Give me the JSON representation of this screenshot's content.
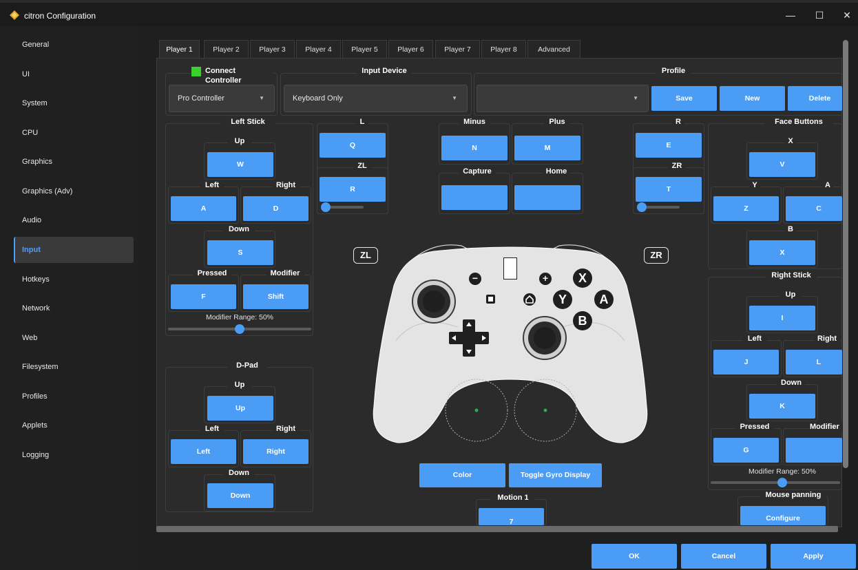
{
  "window": {
    "title": "citron Configuration",
    "minimize": "—",
    "maximize": "☐",
    "close": "✕"
  },
  "sidebar": {
    "items": [
      {
        "label": "General"
      },
      {
        "label": "UI"
      },
      {
        "label": "System"
      },
      {
        "label": "CPU"
      },
      {
        "label": "Graphics"
      },
      {
        "label": "Graphics (Adv)"
      },
      {
        "label": "Audio"
      },
      {
        "label": "Input"
      },
      {
        "label": "Hotkeys"
      },
      {
        "label": "Network"
      },
      {
        "label": "Web"
      },
      {
        "label": "Filesystem"
      },
      {
        "label": "Profiles"
      },
      {
        "label": "Applets"
      },
      {
        "label": "Logging"
      }
    ],
    "active": "Input"
  },
  "tabs": [
    "Player 1",
    "Player 2",
    "Player 3",
    "Player 4",
    "Player 5",
    "Player 6",
    "Player 7",
    "Player 8",
    "Advanced"
  ],
  "header": {
    "connect_label": "Connect Controller",
    "controller_type": "Pro Controller",
    "input_device_label": "Input Device",
    "input_device": "Keyboard Only",
    "profile_label": "Profile",
    "profile_value": "",
    "save": "Save",
    "new": "New",
    "delete": "Delete"
  },
  "left_stick": {
    "title": "Left Stick",
    "up_label": "Up",
    "up": "W",
    "left_label": "Left",
    "left": "A",
    "right_label": "Right",
    "right": "D",
    "down_label": "Down",
    "down": "S",
    "pressed_label": "Pressed",
    "pressed": "F",
    "modifier_label": "Modifier",
    "modifier": "Shift",
    "range_text": "Modifier Range: 50%",
    "range_value": 0.5
  },
  "dpad": {
    "title": "D-Pad",
    "up_label": "Up",
    "up": "Up",
    "left_label": "Left",
    "left": "Left",
    "right_label": "Right",
    "right": "Right",
    "down_label": "Down",
    "down": "Down"
  },
  "shoulder_l": {
    "l_label": "L",
    "l": "Q",
    "zl_label": "ZL",
    "zl": "R",
    "zl_range": 0.05
  },
  "shoulder_r": {
    "r_label": "R",
    "r": "E",
    "zr_label": "ZR",
    "zr": "T",
    "zr_range": 0.05
  },
  "misc": {
    "minus_label": "Minus",
    "minus": "N",
    "plus_label": "Plus",
    "plus": "M",
    "capture_label": "Capture",
    "capture": "",
    "home_label": "Home",
    "home": ""
  },
  "controller_visual": {
    "zl_badge": "ZL",
    "zr_badge": "ZR",
    "a": "A",
    "b": "B",
    "x": "X",
    "y": "Y",
    "minus_glyph": "−",
    "plus_glyph": "+"
  },
  "face_buttons": {
    "title": "Face Buttons",
    "x_label": "X",
    "x": "V",
    "y_label": "Y",
    "y": "Z",
    "a_label": "A",
    "a": "C",
    "b_label": "B",
    "b": "X"
  },
  "right_stick": {
    "title": "Right Stick",
    "up_label": "Up",
    "up": "I",
    "left_label": "Left",
    "left": "J",
    "right_label": "Right",
    "right": "L",
    "down_label": "Down",
    "down": "K",
    "pressed_label": "Pressed",
    "pressed": "G",
    "modifier_label": "Modifier",
    "modifier": "",
    "range_text": "Modifier Range: 50%",
    "range_value": 0.5
  },
  "mouse_panning": {
    "title": "Mouse panning",
    "configure": "Configure"
  },
  "center_buttons": {
    "color": "Color",
    "toggle_gyro": "Toggle Gyro Display"
  },
  "motion": {
    "title": "Motion 1",
    "value": "7"
  },
  "footer": {
    "ok": "OK",
    "cancel": "Cancel",
    "apply": "Apply"
  },
  "colors": {
    "accent": "#4a9cf5",
    "connected": "#39d12c",
    "bg": "#2b2b2b"
  }
}
